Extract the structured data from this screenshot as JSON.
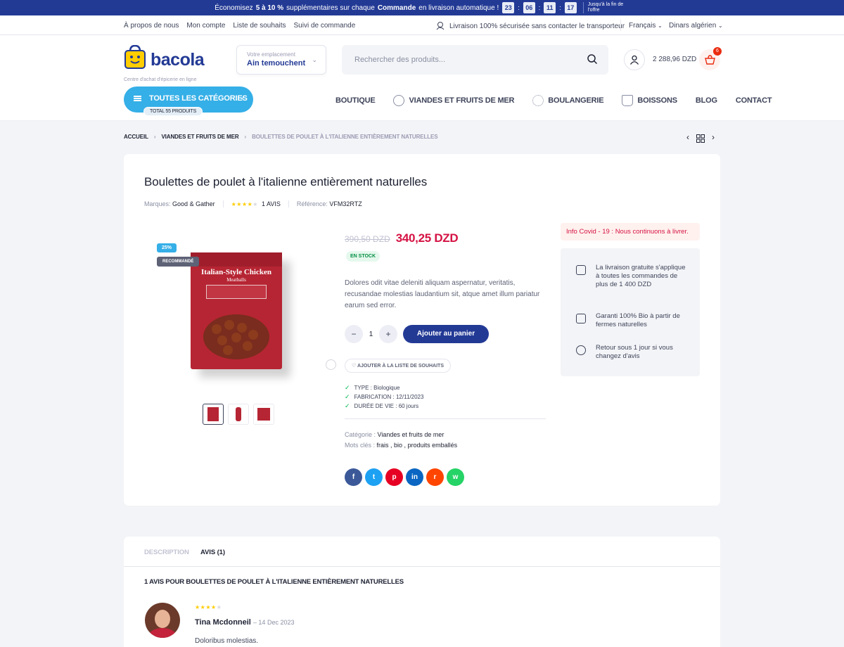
{
  "promo": {
    "pre": "Économisez",
    "pct": "5 à 10 %",
    "mid": "supplémentaires sur chaque",
    "cmd": "Commande",
    "post": "en livraison automatique !",
    "countdown": [
      "23",
      "06",
      "11",
      "17"
    ],
    "end": "Jusqu'à la fin de l'offre"
  },
  "topbar": {
    "links": [
      "À propos de nous",
      "Mon compte",
      "Liste de souhaits",
      "Suivi de commande"
    ],
    "delivery": "Livraison 100% sécurisée sans contacter le transporteur",
    "language": "Français",
    "currency": "Dinars algérien"
  },
  "header": {
    "logo": "bacola",
    "logo_sub": "Centre d'achat d'épicerie en ligne",
    "location_label": "Votre emplacement",
    "location_value": "Ain temouchent",
    "search_placeholder": "Rechercher des produits...",
    "cart_amount": "2 288,96 DZD",
    "cart_count": "6"
  },
  "nav": {
    "all_categories": "TOUTES LES CATÉGORIES",
    "total_products": "TOTAL 55 PRODUITS",
    "items": [
      "BOUTIQUE",
      "VIANDES ET FRUITS DE MER",
      "BOULANGERIE",
      "BOISSONS",
      "BLOG",
      "CONTACT"
    ]
  },
  "breadcrumb": [
    "ACCUEIL",
    "VIANDES ET FRUITS DE MER",
    "BOULETTES DE POULET À L'ITALIENNE ENTIÈREMENT NATURELLES"
  ],
  "product": {
    "title": "Boulettes de poulet à l'italienne entièrement naturelles",
    "brand_label": "Marques:",
    "brand": "Good & Gather",
    "rating": 4,
    "reviews": "1 AVIS",
    "ref_label": "Référence:",
    "ref": "VFM32RTZ",
    "discount_badge": "25%",
    "recommended_badge": "RECOMMANDÉ",
    "package_title": "Italian-Style Chicken",
    "package_sub": "Meatballs",
    "old_price": "390,50 DZD",
    "price": "340,25 DZD",
    "stock": "EN STOCK",
    "description": "Dolores odit vitae deleniti aliquam aspernatur, veritatis, recusandae molestias laudantium sit, atque amet illum pariatur earum sed error.",
    "qty": "1",
    "add_to_cart": "Ajouter au panier",
    "wishlist": "AJOUTER À LA LISTE DE SOUHAITS",
    "specs": [
      {
        "label": "TYPE",
        "value": "Biologique"
      },
      {
        "label": "FABRICATION",
        "value": "12/11/2023"
      },
      {
        "label": "DURÉE DE VIE",
        "value": "60 jours"
      }
    ],
    "category_label": "Catégorie :",
    "category": "Viandes et fruits de mer",
    "tags_label": "Mots clés :",
    "tags": "frais ,  bio ,  produits emballés"
  },
  "share": [
    {
      "icon": "facebook-icon",
      "glyph": "f",
      "color": "#3b5998"
    },
    {
      "icon": "twitter-icon",
      "glyph": "t",
      "color": "#1da1f2"
    },
    {
      "icon": "pinterest-icon",
      "glyph": "p",
      "color": "#e60023"
    },
    {
      "icon": "linkedin-icon",
      "glyph": "in",
      "color": "#0a66c2"
    },
    {
      "icon": "reddit-icon",
      "glyph": "r",
      "color": "#ff4500"
    },
    {
      "icon": "whatsapp-icon",
      "glyph": "w",
      "color": "#25d366"
    }
  ],
  "sidebar": {
    "covid": "Info Covid - 19 : Nous continuons à livrer.",
    "features": [
      "La livraison gratuite s'applique à toutes les commandes de plus de 1 400 DZD",
      "Garanti 100% Bio à partir de fermes naturelles",
      "Retour sous 1 jour si vous changez d'avis"
    ]
  },
  "tabs": {
    "description": "DESCRIPTION",
    "reviews": "AVIS (1)"
  },
  "reviews": {
    "heading": "1 AVIS POUR BOULETTES DE POULET À L'ITALIENNE ENTIÈREMENT NATURELLES",
    "name": "Tina Mcdonneil",
    "date": "– 14 Dec 2023",
    "rating": 4,
    "text": "Doloribus molestias."
  },
  "colors": {
    "brand": "#233a95",
    "accent": "#35afe7",
    "price": "#d51243",
    "stock": "#038e42"
  }
}
